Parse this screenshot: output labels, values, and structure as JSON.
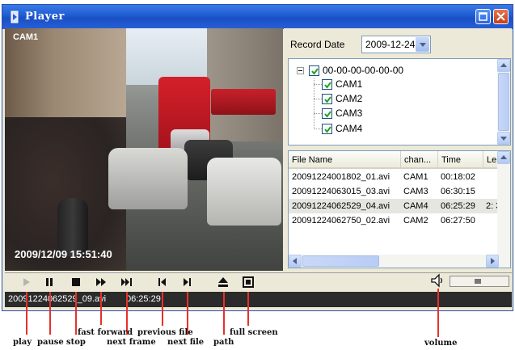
{
  "window": {
    "title": "Player"
  },
  "video": {
    "camera_label": "CAM1",
    "timestamp": "2009/12/09 15:51:40"
  },
  "record_date": {
    "label": "Record Date",
    "value": "2009-12-24"
  },
  "tree": {
    "root": "00-00-00-00-00-00",
    "cameras": [
      "CAM1",
      "CAM2",
      "CAM3",
      "CAM4"
    ]
  },
  "file_list": {
    "columns": [
      "File Name",
      "chan...",
      "Time",
      "Leng"
    ],
    "rows": [
      [
        "20091224001802_01.avi",
        "CAM1",
        "00:18:02",
        ""
      ],
      [
        "20091224063015_03.avi",
        "CAM3",
        "06:30:15",
        ""
      ],
      [
        "20091224062529_04.avi",
        "CAM4",
        "06:25:29",
        "2: 3"
      ],
      [
        "20091224062750_02.avi",
        "CAM2",
        "06:27:50",
        ""
      ]
    ],
    "selected_row": 2
  },
  "status": {
    "file": "20091224062529_09.avi",
    "time": "06:25:29"
  },
  "icons": {
    "play": "play-icon",
    "pause": "pause-icon",
    "stop": "stop-icon",
    "fast_forward": "fast-forward-icon",
    "next_frame": "next-frame-icon",
    "previous_file": "previous-file-icon",
    "next_file": "next-file-icon",
    "path": "eject-icon",
    "full_screen": "full-screen-icon",
    "volume": "speaker-icon"
  },
  "annotations": {
    "play": "play",
    "pause": "pause",
    "stop": "stop",
    "fast_forward": "fast forward",
    "next_frame": "next frame",
    "previous_file": "previous file",
    "next_file": "next file",
    "path": "path",
    "full_screen": "full screen",
    "volume": "volume"
  },
  "colors": {
    "title_bar": "#1f5bd0",
    "annotation_line": "#e8302a",
    "checkbox_check": "#21a121"
  }
}
